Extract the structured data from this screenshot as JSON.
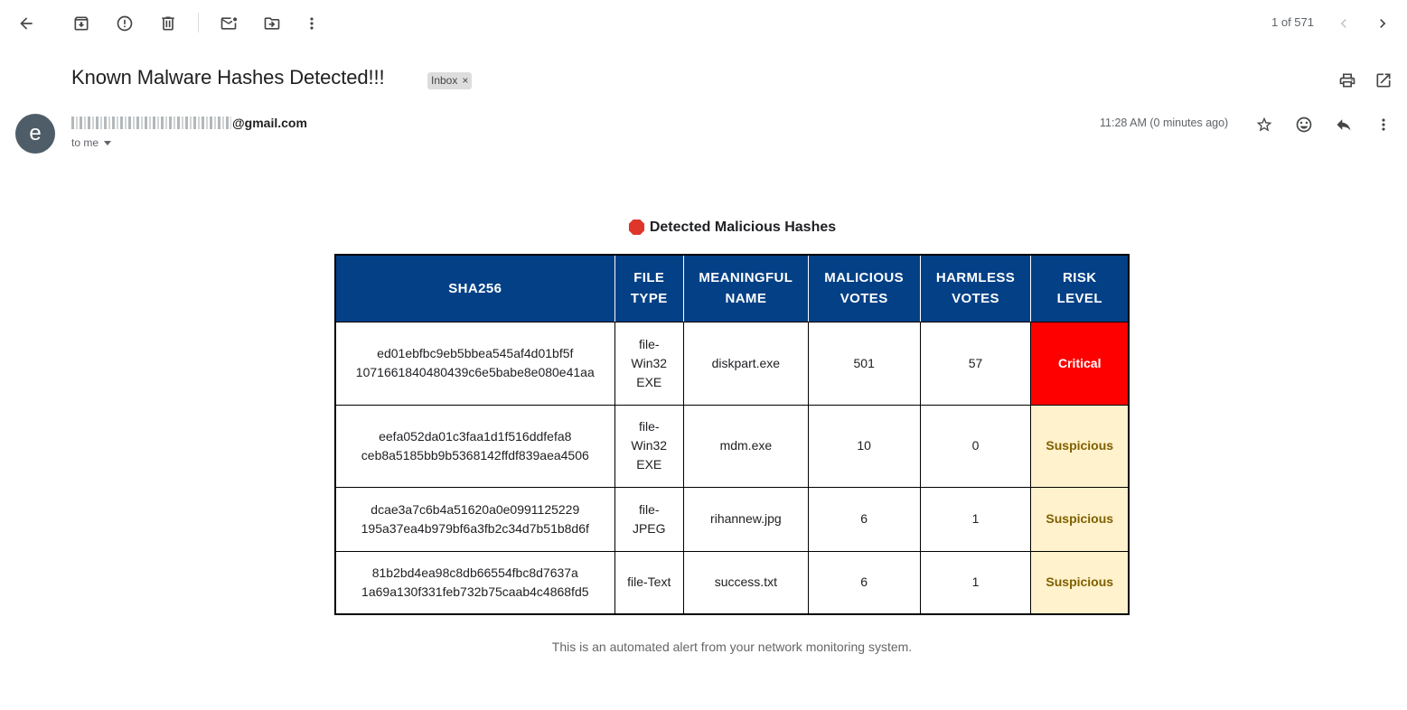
{
  "toolbar": {
    "back_icon": "arrow-left-icon",
    "archive_icon": "archive-icon",
    "report_spam_icon": "report-spam-icon",
    "delete_icon": "trash-icon",
    "mark_unread_icon": "mark-unread-icon",
    "move_to_icon": "move-to-folder-icon",
    "more_icon": "more-vertical-icon"
  },
  "pager": {
    "text": "1 of 571"
  },
  "email": {
    "subject": "Known Malware Hashes Detected!!!",
    "label": "Inbox",
    "label_remove": "×",
    "avatar_letter": "e",
    "sender_domain": "@gmail.com",
    "recipient": "to me",
    "timestamp": "11:28 AM (0 minutes ago)"
  },
  "body": {
    "heading_icon": "stop-sign-icon",
    "heading": "Detected Malicious Hashes",
    "table": {
      "headers": [
        [
          "SHA256"
        ],
        [
          "FILE",
          "TYPE"
        ],
        [
          "MEANINGFUL",
          "NAME"
        ],
        [
          "MALICIOUS",
          "VOTES"
        ],
        [
          "HARMLESS",
          "VOTES"
        ],
        [
          "RISK",
          "LEVEL"
        ]
      ],
      "rows": [
        {
          "sha256": [
            "ed01ebfbc9eb5bbea545af4d01bf5f",
            "1071661840480439c6e5babe8e080e41aa"
          ],
          "file_type": [
            "file-",
            "Win32",
            "EXE"
          ],
          "name": "diskpart.exe",
          "malicious": "501",
          "harmless": "57",
          "risk": "Critical",
          "risk_class": "critical"
        },
        {
          "sha256": [
            "eefa052da01c3faa1d1f516ddfefa8",
            "ceb8a5185bb9b5368142ffdf839aea4506"
          ],
          "file_type": [
            "file-",
            "Win32",
            "EXE"
          ],
          "name": "mdm.exe",
          "malicious": "10",
          "harmless": "0",
          "risk": "Suspicious",
          "risk_class": "suspicious"
        },
        {
          "sha256": [
            "dcae3a7c6b4a51620a0e0991125229",
            "195a37ea4b979bf6a3fb2c34d7b51b8d6f"
          ],
          "file_type": [
            "file-",
            "JPEG"
          ],
          "name": "rihannew.jpg",
          "malicious": "6",
          "harmless": "1",
          "risk": "Suspicious",
          "risk_class": "suspicious"
        },
        {
          "sha256": [
            "81b2bd4ea98c8db66554fbc8d7637a",
            "1a69a130f331feb732b75caab4c4868fd5"
          ],
          "file_type": [
            "file-Text"
          ],
          "name": "success.txt",
          "malicious": "6",
          "harmless": "1",
          "risk": "Suspicious",
          "risk_class": "suspicious"
        }
      ]
    },
    "footer": "This is an automated alert from your network monitoring system."
  },
  "colors": {
    "header_bg": "#034086",
    "critical": "#ff0000",
    "suspicious_bg": "#fff2cc",
    "suspicious_text": "#7f6000"
  }
}
